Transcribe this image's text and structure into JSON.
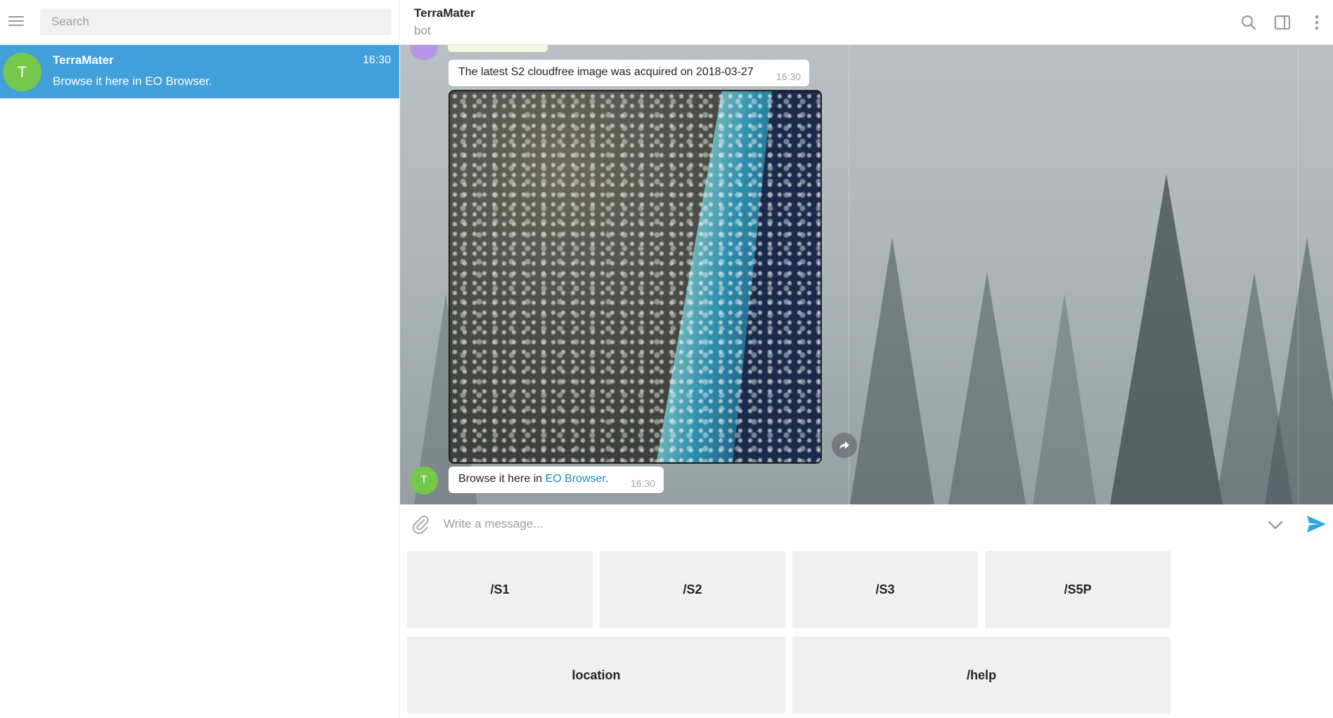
{
  "sidebar": {
    "search_placeholder": "Search",
    "chats": [
      {
        "avatar_letter": "T",
        "name": "TerraMater",
        "time": "16:30",
        "preview": "Browse it here in EO Browser."
      }
    ]
  },
  "header": {
    "title": "TerraMater",
    "status": "bot"
  },
  "messages": [
    {
      "text": "The latest S2 cloudfree image was acquired on 2018-03-27",
      "time": "16:30"
    },
    {
      "text_before": "Browse it here in ",
      "link": "EO Browser",
      "text_after": ".",
      "time": "16:30",
      "avatar_letter": "T"
    }
  ],
  "composer": {
    "placeholder": "Write a message..."
  },
  "keyboard": {
    "row1": [
      "/S1",
      "/S2",
      "/S3",
      "/S5P"
    ],
    "row2": [
      "location",
      "/help"
    ]
  },
  "colors": {
    "accent": "#419fd9",
    "avatar_green": "#76c84d",
    "link": "#168acd",
    "send": "#2ea6e0"
  },
  "icons": [
    "menu-icon",
    "search-icon",
    "sidebar-panel-icon",
    "more-vertical-icon",
    "share-icon",
    "paperclip-icon",
    "chevron-down-icon",
    "send-icon"
  ]
}
